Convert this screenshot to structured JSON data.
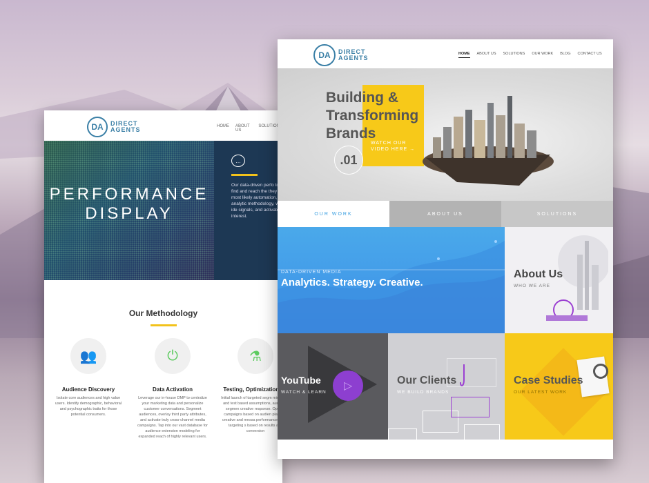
{
  "back_page": {
    "logo": {
      "mark": "DA",
      "line1": "DIRECT",
      "line2": "AGENTS"
    },
    "menu": [
      "HOME",
      "ABOUT US",
      "SOLUTIONS"
    ],
    "hero": {
      "title_line1": "PERFORMANCE",
      "title_line2": "DISPLAY",
      "chat_icon": "chat-bubble-icon",
      "paragraph": "Our data-driven perfo to find and reach the they are most likely automation, analytic methodology, we ide signals, and activate interest."
    },
    "methodology": {
      "title": "Our Methodology",
      "features": [
        {
          "icon": "users-icon",
          "title": "Audience Discovery",
          "text": "Isolate core audiences and high value users. Identify demographic, behavioral and psychographic traits for those potential consumers."
        },
        {
          "icon": "power-icon",
          "title": "Data Activation",
          "text": "Leverage our in-house DMP to centralize your marketing data and personalize customer conversations. Segment audiences, overlay third party attributes, and activate truly cross-channel media campaigns. Tap into our vast database for audience extension modeling for expanded reach of highly relevant users."
        },
        {
          "icon": "flask-icon",
          "title": "Testing, Optimizations &",
          "text": "Initial launch of targeted segm microsites and test based assumptions, audience segmen creative response. Optimiz campaigns based on audien platform, creative and messa performance. Grow targeting s based on results and conversion"
        }
      ]
    }
  },
  "front_page": {
    "logo": {
      "mark": "DA",
      "line1": "DIRECT",
      "line2": "AGENTS"
    },
    "menu": [
      "HOME",
      "ABOUT US",
      "SOLUTIONS",
      "OUR WORK",
      "BLOG",
      "CONTACT US"
    ],
    "hero": {
      "line1": "Building &",
      "line2": "Transforming",
      "line3": "Brands",
      "watch_line1": "WATCH OUR",
      "watch_line2": "VIDEO HERE →",
      "slide_number": ".01"
    },
    "tabs": [
      "OUR WORK",
      "ABOUT US",
      "SOLUTIONS"
    ],
    "tiles": {
      "analytics": {
        "tag": "DATA-DRIVEN MEDIA",
        "title": "Analytics. Strategy. Creative."
      },
      "about": {
        "title": "About Us",
        "subtitle": "WHO WE ARE"
      },
      "youtube": {
        "title": "YouTube",
        "subtitle": "WATCH & LEARN",
        "play_glyph": "▷"
      },
      "clients": {
        "title": "Our Clients",
        "subtitle": "WE BUILD BRANDS"
      },
      "cases": {
        "title": "Case Studies",
        "subtitle": "OUR LATEST WORK"
      }
    },
    "colors": {
      "accent_yellow": "#f7c919",
      "accent_blue": "#3a9ee0",
      "accent_purple": "#8d3fd0"
    }
  }
}
